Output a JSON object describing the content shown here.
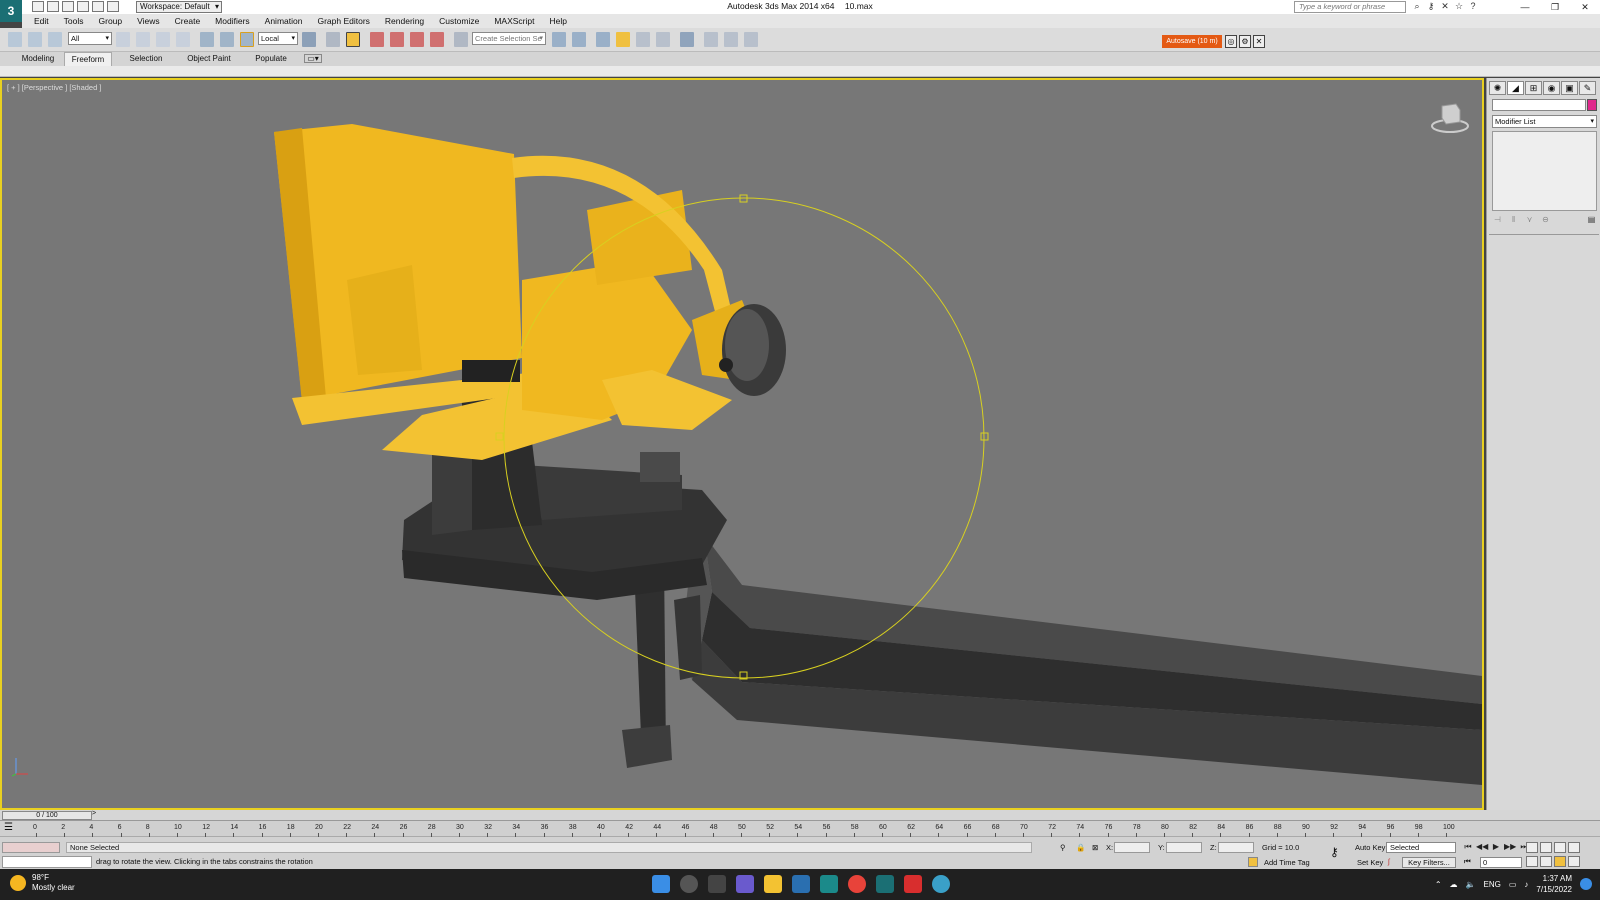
{
  "titlebar": {
    "app_title": "Autodesk 3ds Max  2014 x64",
    "file_name": "10.max",
    "workspace": "Workspace: Default",
    "search_placeholder": "Type a keyword or phrase",
    "logo_letter": "3"
  },
  "menu": [
    "Edit",
    "Tools",
    "Group",
    "Views",
    "Create",
    "Modifiers",
    "Animation",
    "Graph Editors",
    "Rendering",
    "Customize",
    "MAXScript",
    "Help"
  ],
  "toolbar": {
    "filter": "All",
    "coord_system": "Local",
    "selection_set": "Create Selection Se",
    "autosave": "Autosave (10 m)"
  },
  "ribbon_tabs": [
    "Modeling",
    "Freeform",
    "Selection",
    "Object Paint",
    "Populate"
  ],
  "ribbon_active": "Freeform",
  "viewport": {
    "label": "[ + ] [Perspective ] [Shaded ]"
  },
  "command_panel": {
    "modifier_list": "Modifier List",
    "object_color": "#e0288c"
  },
  "timeline": {
    "frame_display": "0 / 100",
    "ticks": [
      "0",
      "2",
      "4",
      "6",
      "8",
      "10",
      "12",
      "14",
      "16",
      "18",
      "20",
      "22",
      "24",
      "26",
      "28",
      "30",
      "32",
      "34",
      "36",
      "38",
      "40",
      "42",
      "44",
      "46",
      "48",
      "50",
      "52",
      "54",
      "56",
      "58",
      "60",
      "62",
      "64",
      "66",
      "68",
      "70",
      "72",
      "74",
      "76",
      "78",
      "80",
      "82",
      "84",
      "86",
      "88",
      "90",
      "92",
      "94",
      "96",
      "98",
      "100"
    ]
  },
  "status": {
    "selection": "None Selected",
    "prompt": "drag to rotate the view.  Clicking in the tabs constrains the rotation",
    "x_label": "X:",
    "y_label": "Y:",
    "z_label": "Z:",
    "grid": "Grid = 10.0",
    "add_time_tag": "Add Time Tag",
    "auto_key": "Auto Key",
    "set_key": "Set Key",
    "key_mode": "Selected",
    "key_filters": "Key Filters...",
    "current_frame": "0"
  },
  "taskbar": {
    "temperature": "98°F",
    "weather": "Mostly clear",
    "language": "ENG",
    "time": "1:37 AM",
    "date": "7/15/2022"
  },
  "colors": {
    "viewport_border": "#e8d020",
    "autosave_bg": "#e45a14",
    "model_yellow": "#f0b820",
    "model_dark": "#3a3a3a"
  }
}
